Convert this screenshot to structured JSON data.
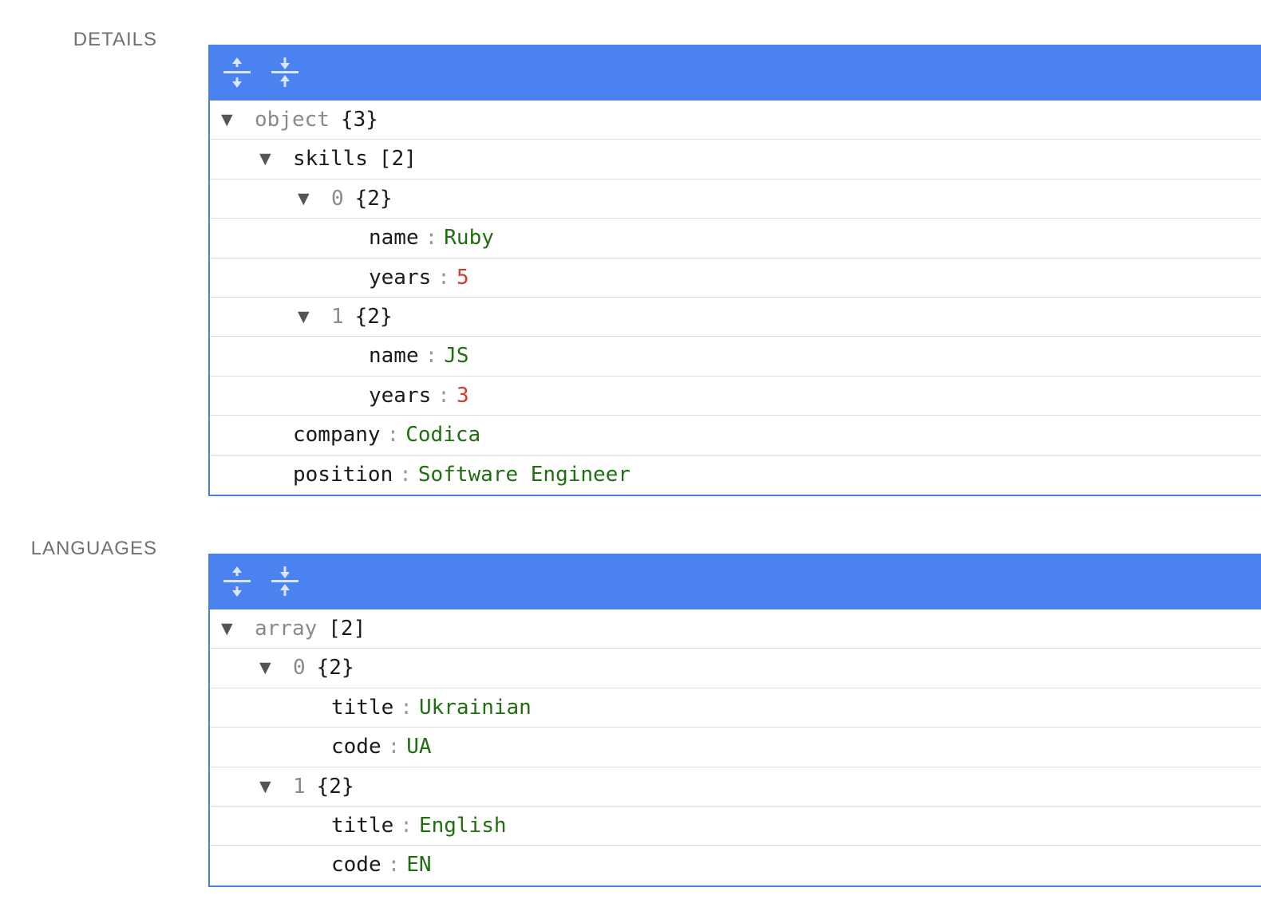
{
  "sections": {
    "details": {
      "label": "DETAILS",
      "root": {
        "name": "object",
        "count": "{3}"
      },
      "skills": {
        "name": "skills",
        "count": "[2]"
      },
      "skill0": {
        "index": "0",
        "count": "{2}",
        "name_key": "name",
        "name_val": "Ruby",
        "years_key": "years",
        "years_val": "5"
      },
      "skill1": {
        "index": "1",
        "count": "{2}",
        "name_key": "name",
        "name_val": "JS",
        "years_key": "years",
        "years_val": "3"
      },
      "company": {
        "key": "company",
        "val": "Codica"
      },
      "position": {
        "key": "position",
        "val": "Software Engineer"
      }
    },
    "languages": {
      "label": "LANGUAGES",
      "root": {
        "name": "array",
        "count": "[2]"
      },
      "lang0": {
        "index": "0",
        "count": "{2}",
        "title_key": "title",
        "title_val": "Ukrainian",
        "code_key": "code",
        "code_val": "UA"
      },
      "lang1": {
        "index": "1",
        "count": "{2}",
        "title_key": "title",
        "title_val": "English",
        "code_key": "code",
        "code_val": "EN"
      }
    }
  },
  "symbols": {
    "colon": ":",
    "caret": "▼"
  },
  "icons": {
    "expand": "expand-all-icon",
    "collapse": "collapse-all-icon"
  },
  "colors": {
    "toolbar": "#4a83f0",
    "border": "#4a7ee8",
    "string": "#1f6e0f",
    "number": "#d43b2a"
  }
}
